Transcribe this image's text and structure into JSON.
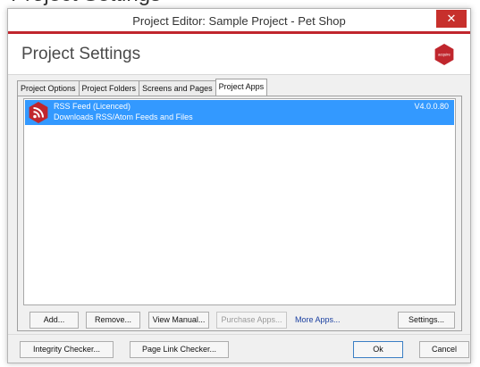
{
  "partial_heading": "Project Settings",
  "window": {
    "title": "Project Editor: Sample Project - Pet Shop",
    "close_label": "✕"
  },
  "header": {
    "title": "Project Settings",
    "logo_text": "acquire"
  },
  "tabs": [
    {
      "label": "Project Options",
      "active": false
    },
    {
      "label": "Project Folders",
      "active": false
    },
    {
      "label": "Screens and Pages",
      "active": false
    },
    {
      "label": "Project Apps",
      "active": true
    }
  ],
  "apps": [
    {
      "name": "RSS Feed  (Licenced)",
      "description": "Downloads RSS/Atom Feeds and Files",
      "version": "V4.0.0.80",
      "icon": "rss-icon",
      "selected": true
    }
  ],
  "panel_buttons": {
    "add": "Add...",
    "remove": "Remove...",
    "view_manual": "View Manual...",
    "purchase": "Purchase Apps...",
    "more_apps": "More Apps...",
    "settings": "Settings..."
  },
  "footer_buttons": {
    "integrity": "Integrity Checker...",
    "page_link": "Page Link Checker...",
    "ok": "Ok",
    "cancel": "Cancel"
  },
  "colors": {
    "accent_red": "#c0262d",
    "selection_blue": "#3399ff",
    "link_blue": "#1a3fa0"
  }
}
